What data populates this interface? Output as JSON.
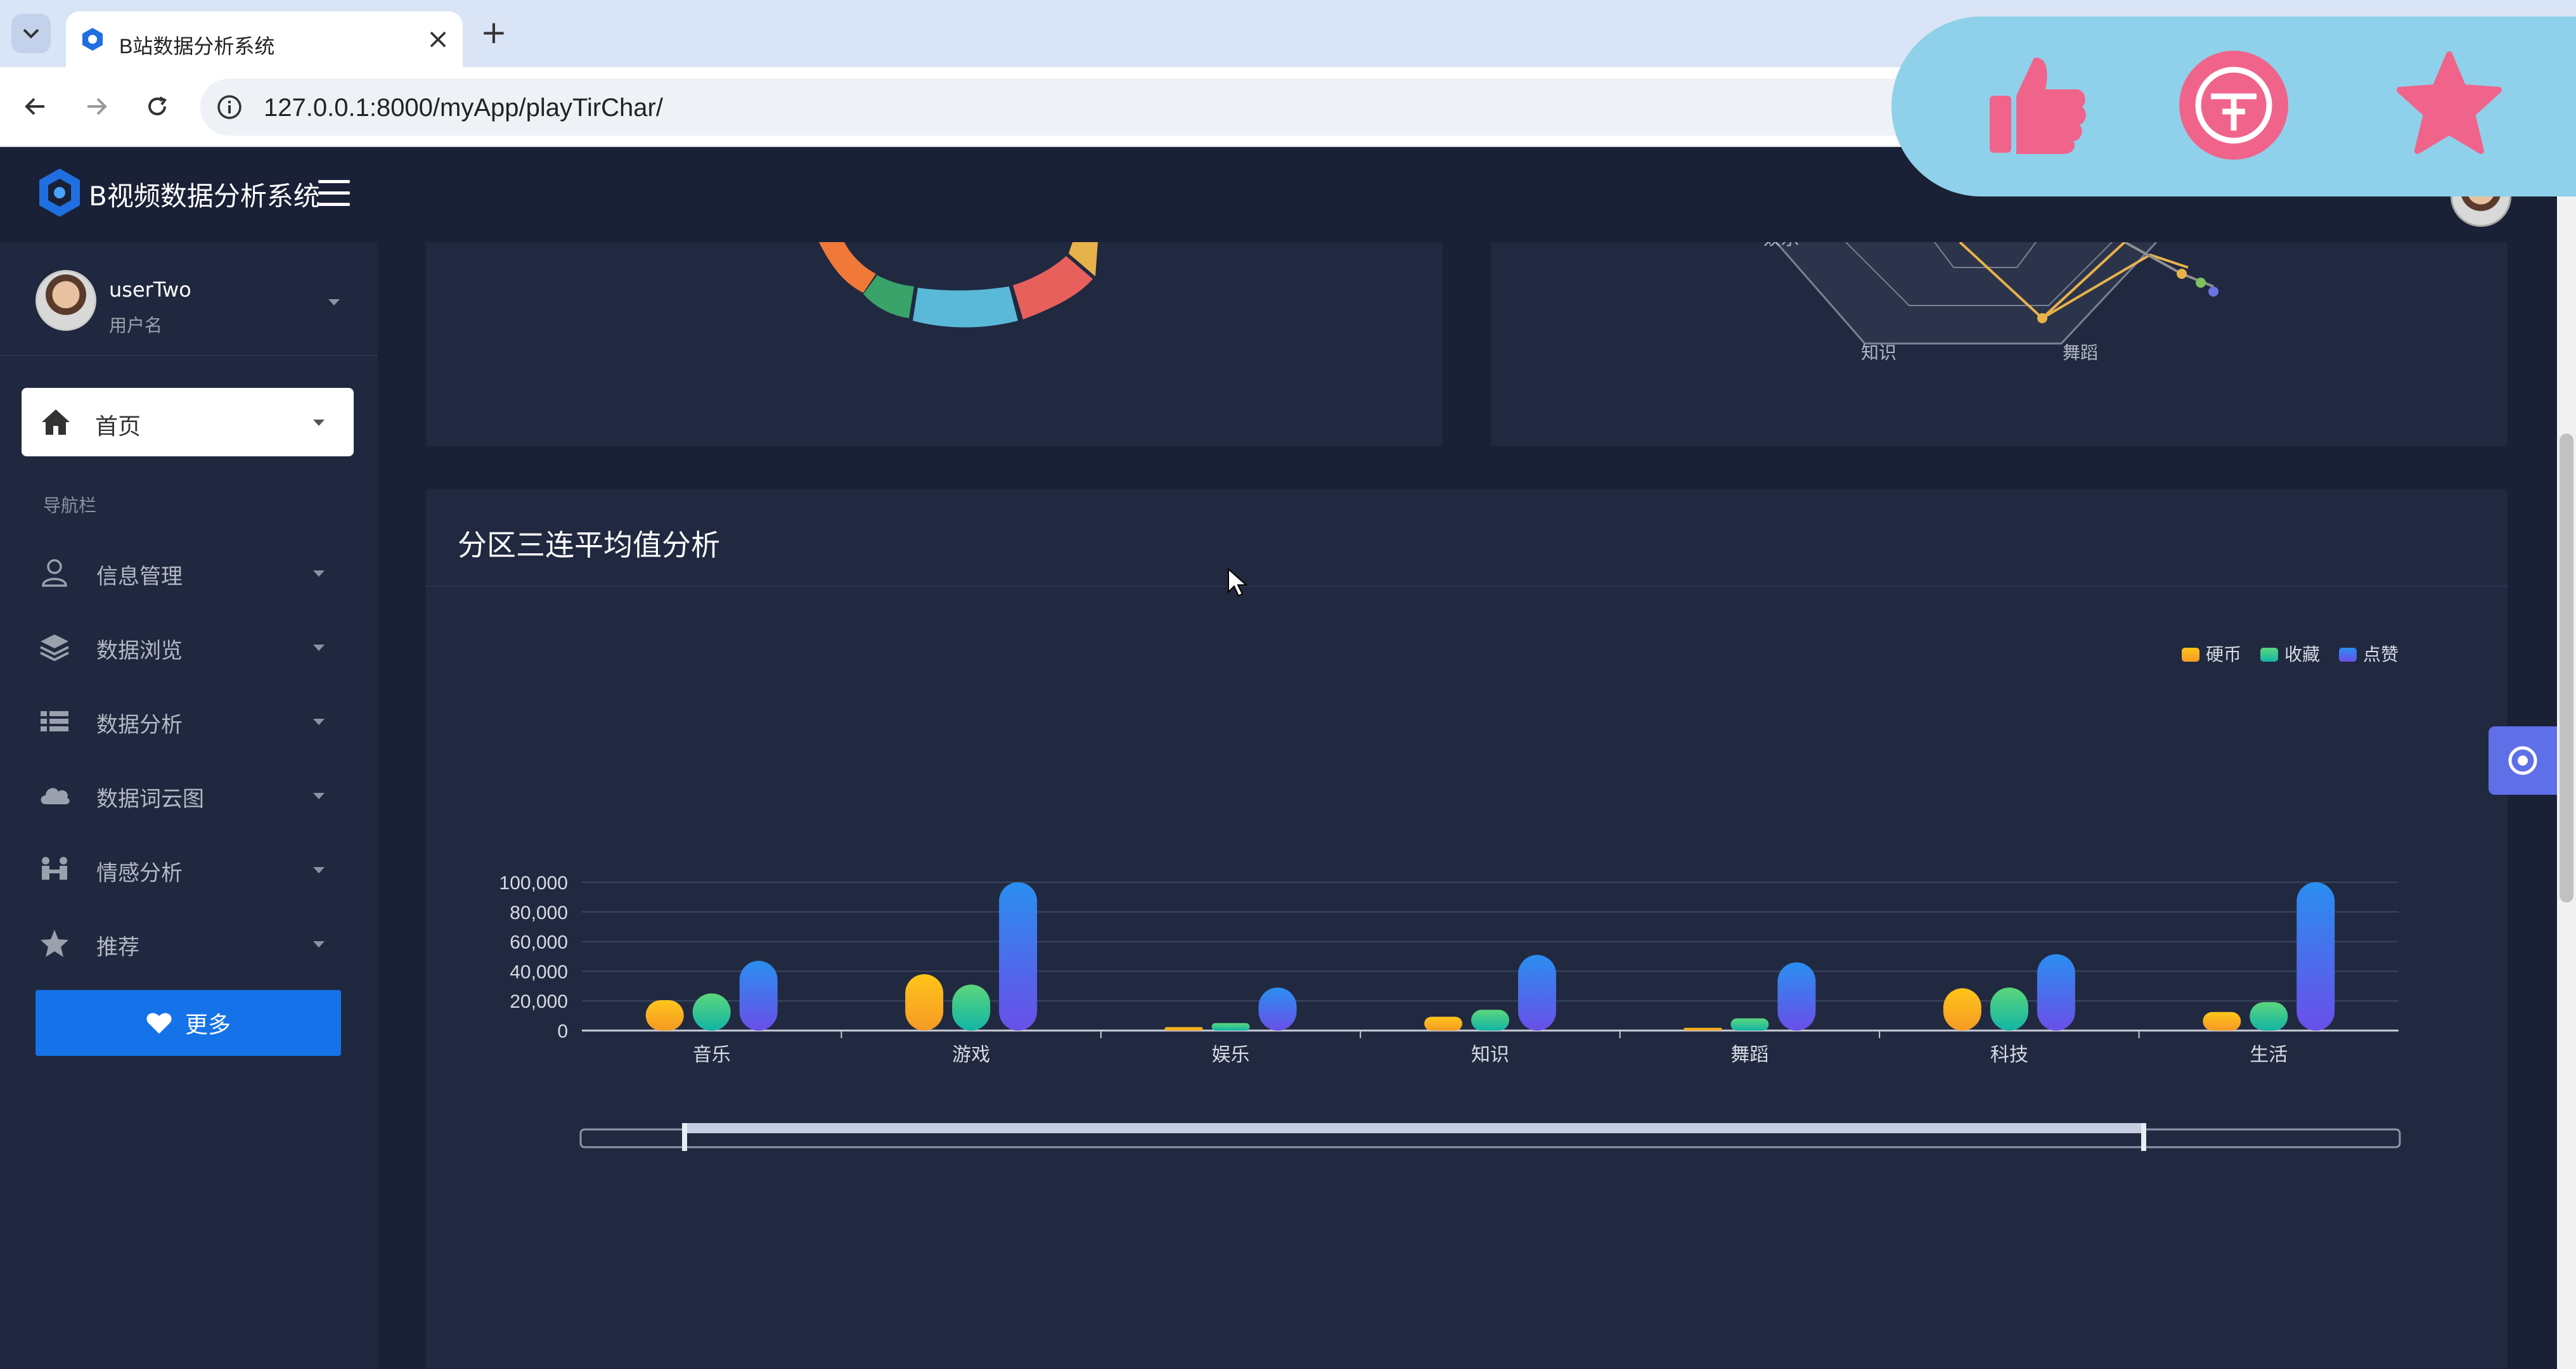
{
  "browser": {
    "tab_title": "B站数据分析系统",
    "tab_close": "×",
    "new_tab": "+",
    "url": "127.0.0.1:8000/myApp/playTirChar/"
  },
  "sidebar": {
    "brand_title": "B视频数据分析系统",
    "user": {
      "name": "userTwo",
      "role": "用户名"
    },
    "home_label": "首页",
    "section_label": "导航栏",
    "items": [
      {
        "label": "信息管理",
        "icon": "user-icon"
      },
      {
        "label": "数据浏览",
        "icon": "layers-icon"
      },
      {
        "label": "数据分析",
        "icon": "list-icon"
      },
      {
        "label": "数据词云图",
        "icon": "cloud-icon"
      },
      {
        "label": "情感分析",
        "icon": "people-icon"
      },
      {
        "label": "推荐",
        "icon": "star-icon"
      }
    ],
    "more_label": "更多"
  },
  "radar_partial": {
    "labels": [
      "娱乐",
      "知识",
      "舞蹈"
    ]
  },
  "main": {
    "card_title": "分区三连平均值分析"
  },
  "chart_data": {
    "type": "bar",
    "categories": [
      "音乐",
      "游戏",
      "娱乐",
      "知识",
      "舞蹈",
      "科技",
      "生活"
    ],
    "series": [
      {
        "name": "硬币",
        "values": [
          20500,
          38000,
          2300,
          9300,
          1800,
          28500,
          12500
        ],
        "color": "#f5b820"
      },
      {
        "name": "收藏",
        "values": [
          25000,
          31000,
          5000,
          14000,
          8200,
          29000,
          19200
        ],
        "color": "#3ecf8e"
      },
      {
        "name": "点赞",
        "values": [
          47000,
          100000,
          29000,
          51000,
          46000,
          51500,
          100000
        ],
        "color": "#3a86f0"
      }
    ],
    "yticks": [
      "0",
      "20,000",
      "40,000",
      "60,000",
      "80,000",
      "100,000"
    ],
    "ylim": [
      0,
      100000
    ],
    "legend_position": "top-right",
    "grid": true,
    "datazoom": true
  },
  "colors": {
    "accent": "#1572e8",
    "overlay": "#8fd1ea",
    "overlay_icon": "#f0648c"
  }
}
